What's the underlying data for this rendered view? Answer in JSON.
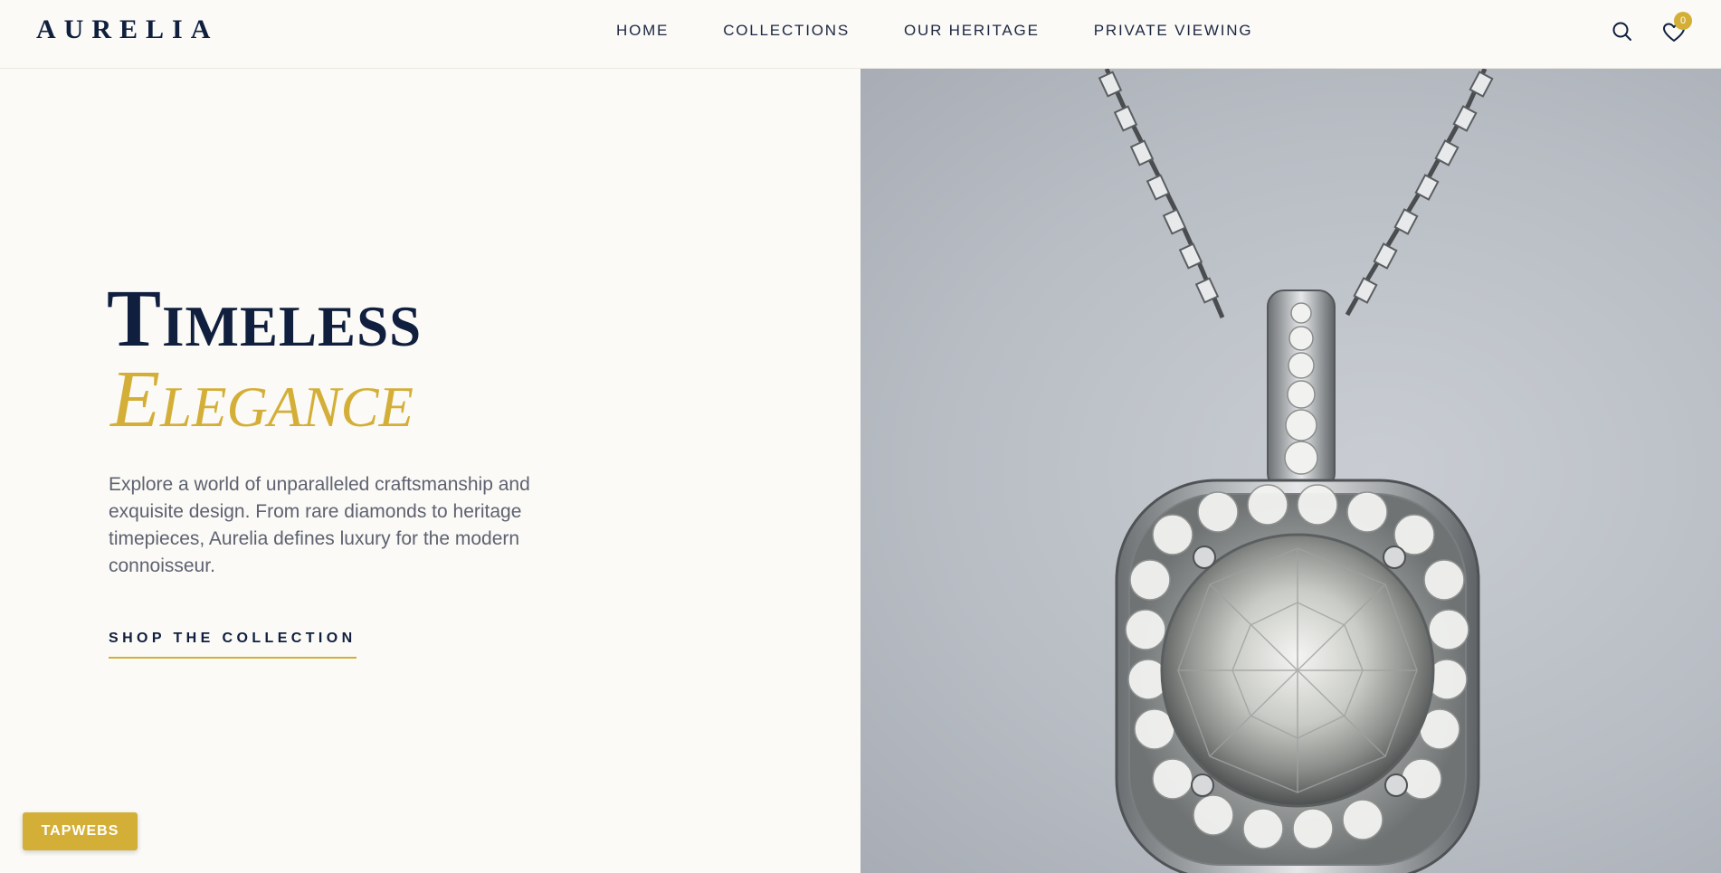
{
  "brand": {
    "logo": "AURELIA"
  },
  "nav": {
    "items": [
      "HOME",
      "COLLECTIONS",
      "OUR HERITAGE",
      "PRIVATE VIEWING"
    ]
  },
  "header": {
    "wishlist_count": "0"
  },
  "hero": {
    "title_line1": "Timeless",
    "title_line2": "Elegance",
    "description": "Explore a world of unparalleled craftsmanship and exquisite design. From rare diamonds to heritage timepieces, Aurelia defines luxury for the modern connoisseur.",
    "cta_label": "SHOP THE COLLECTION"
  },
  "floating_button": {
    "label": "TAPWEBS"
  },
  "icons": {
    "search": "search-icon",
    "wishlist": "heart-icon"
  },
  "colors": {
    "navy": "#0f1f3d",
    "gold": "#d4af37",
    "background": "#fbfaf7"
  }
}
